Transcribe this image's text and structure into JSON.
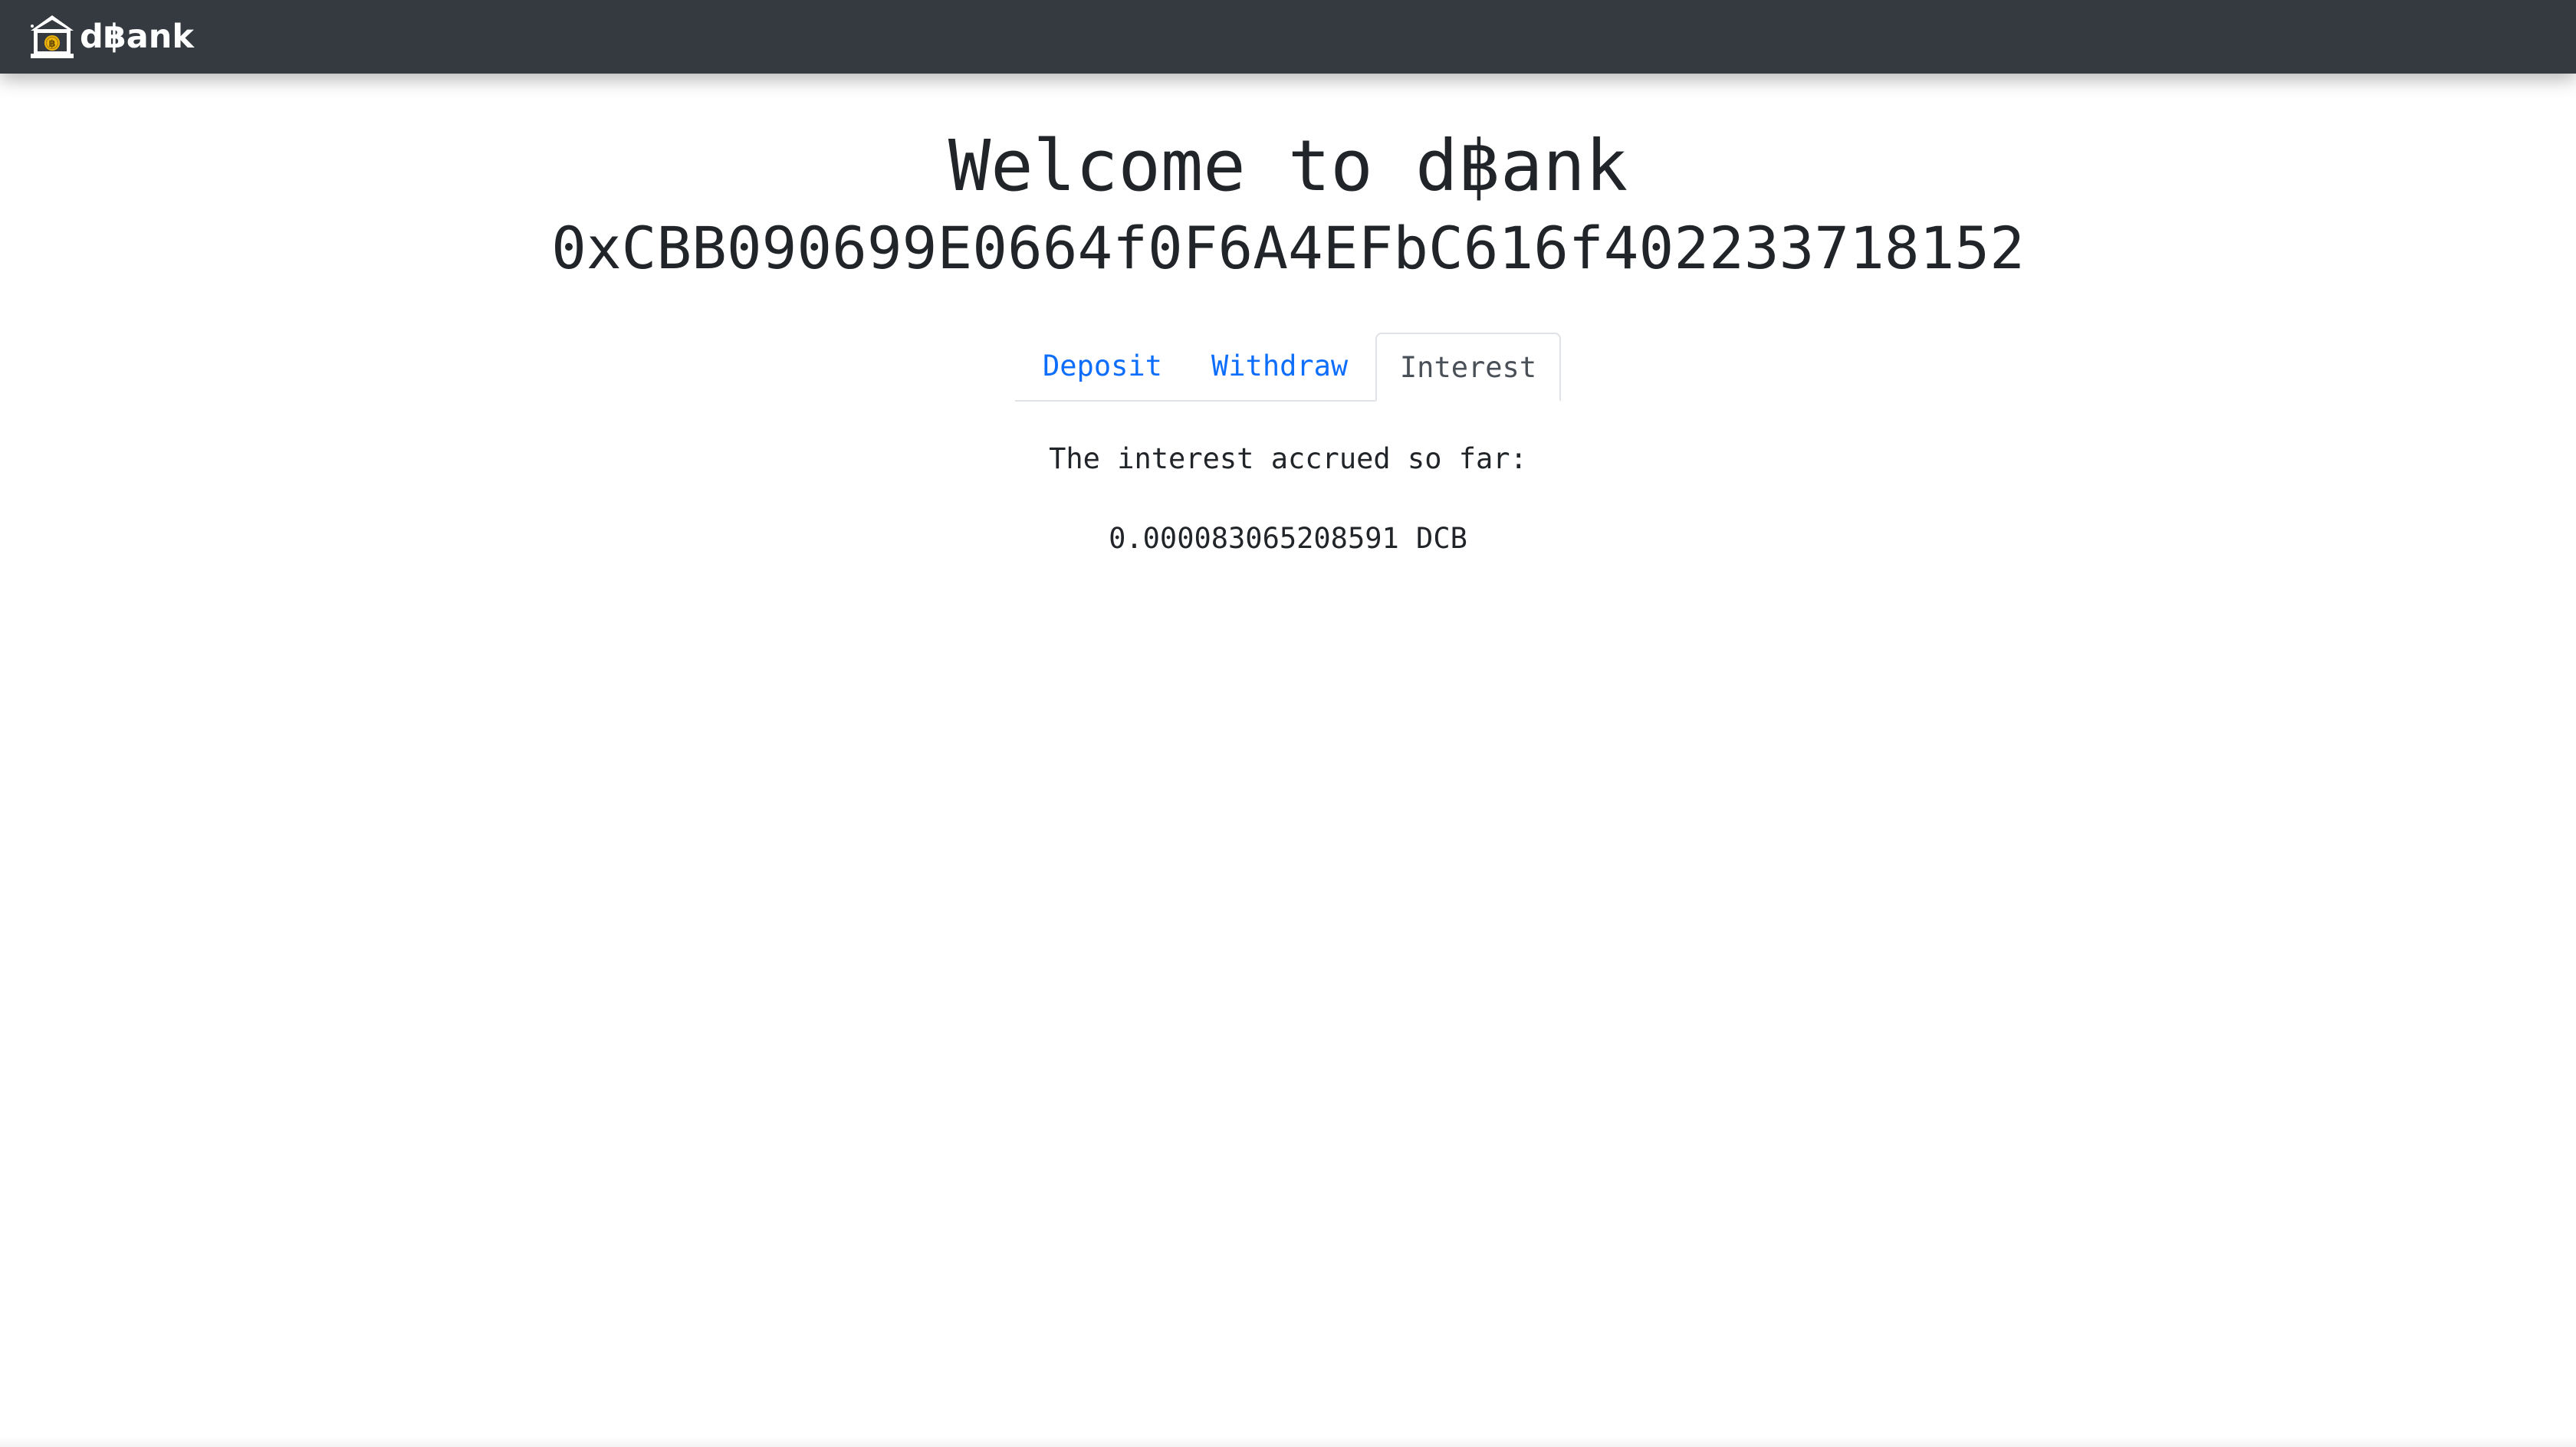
{
  "navbar": {
    "brand_text": "d฿ank",
    "logo_icon": "bank-bitcoin-icon",
    "background": "#343a40"
  },
  "main": {
    "welcome": "Welcome to d฿ank",
    "address": "0xCBB090699E0664f0F6A4EFbC616f402233718152",
    "tabs": [
      {
        "label": "Deposit",
        "active": false
      },
      {
        "label": "Withdraw",
        "active": false
      },
      {
        "label": "Interest",
        "active": true
      }
    ],
    "interest_label": "The interest accrued so far:",
    "interest_value": "0.000083065208591 DCB"
  },
  "colors": {
    "link": "#0d6efd",
    "active_tab": "#495057",
    "text": "#212529",
    "coin": "#f0b90b"
  }
}
